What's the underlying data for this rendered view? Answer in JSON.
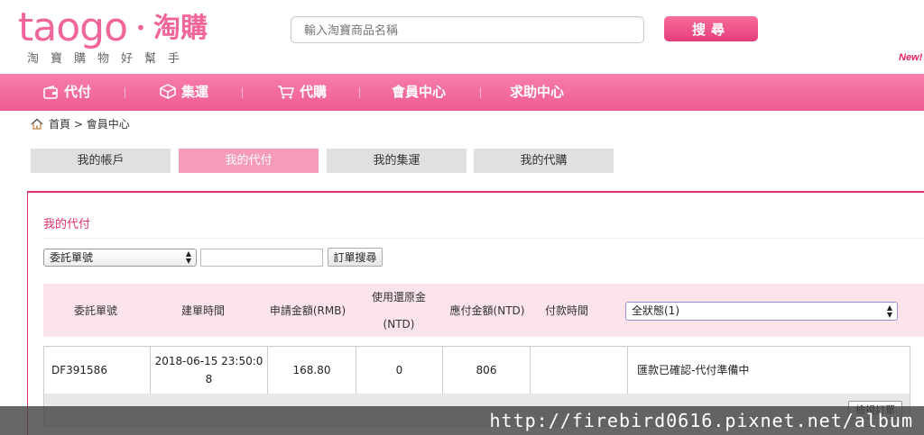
{
  "header": {
    "logo_text": "taogo",
    "logo_dot": "•",
    "logo_cn": "淘購",
    "tagline": "淘寶購物好幫手",
    "search_placeholder": "輸入淘寶商品名稱",
    "search_button": "搜尋",
    "new_badge": "New!"
  },
  "nav": {
    "items": [
      {
        "label": "代付",
        "icon": "wallet-icon"
      },
      {
        "label": "集運",
        "icon": "box-icon"
      },
      {
        "label": "代購",
        "icon": "cart-icon"
      },
      {
        "label": "會員中心"
      },
      {
        "label": "求助中心"
      }
    ]
  },
  "breadcrumb": {
    "home": "首頁",
    "separator": ">",
    "current": "會員中心"
  },
  "tabs": [
    {
      "label": "我的帳戶",
      "active": false
    },
    {
      "label": "我的代付",
      "active": true
    },
    {
      "label": "我的集運",
      "active": false
    },
    {
      "label": "我的代購",
      "active": false
    }
  ],
  "panel": {
    "title": "我的代付",
    "filter": {
      "select_value": "委託單號",
      "input_value": "",
      "search_button": "訂單搜尋"
    },
    "table": {
      "headers": [
        "委託單號",
        "建單時間",
        "申請金額(RMB)",
        "使用還原金",
        "(NTD)",
        "應付金額(NTD)",
        "付款時間"
      ],
      "status_select": "全狀態(1)",
      "rows": [
        {
          "order_no": "DF391586",
          "created_line1": "2018-06-15 23:50:0",
          "created_line2": "8",
          "amount_rmb": "168.80",
          "refund_ntd": "0",
          "payable_ntd": "806",
          "paid_time": "",
          "status": "匯款已確認-代付準備中"
        }
      ],
      "detail_button": "檢視訂單"
    }
  },
  "watermark": "http://firebird0616.pixnet.net/album",
  "colors": {
    "brand_pink": "#f0669a",
    "nav_pink": "#ef5b93",
    "accent": "#e0306e",
    "header_row": "#fbe4e9"
  }
}
